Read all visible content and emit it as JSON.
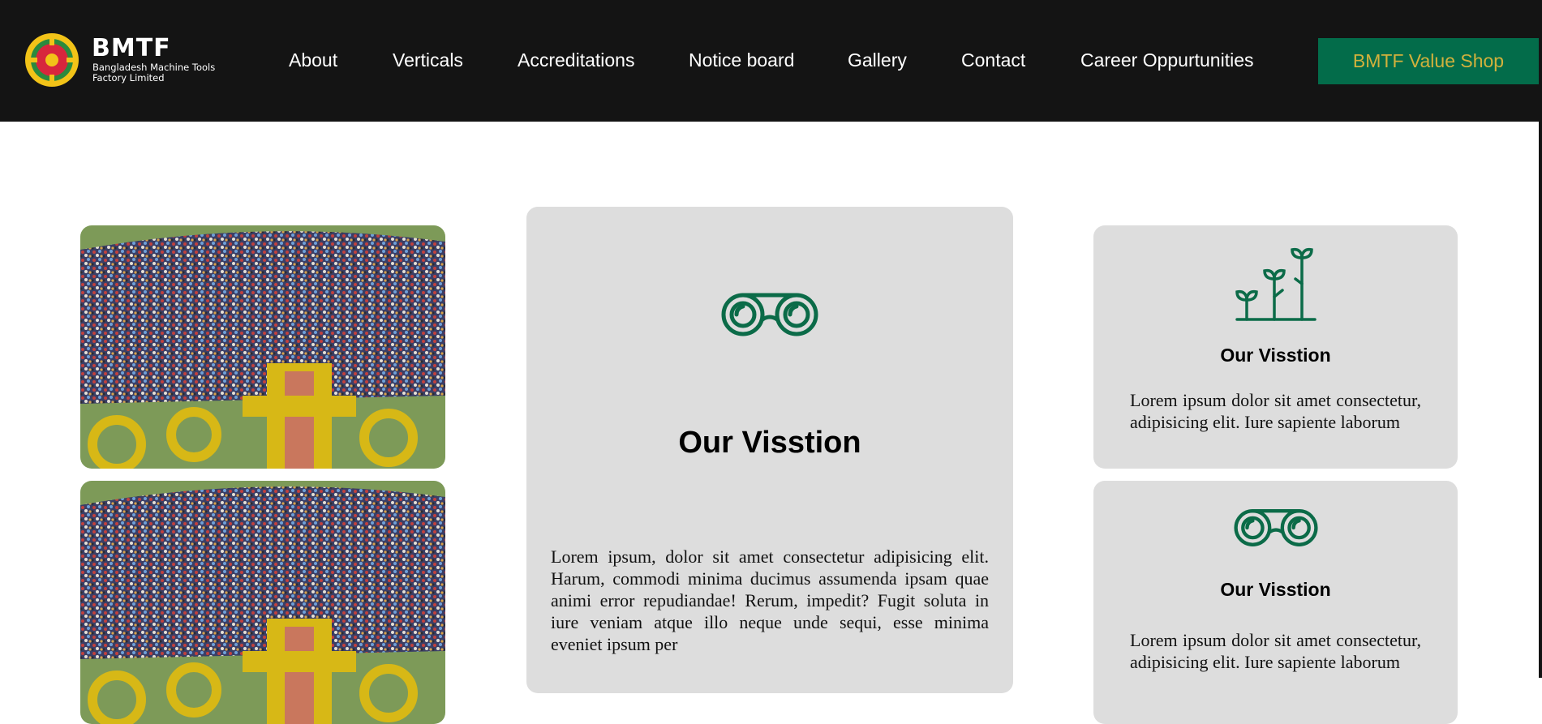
{
  "brand": {
    "name": "BMTF",
    "subtitle": "Bangladesh Machine Tools Factory Limited",
    "colors": {
      "header_bg": "#141414",
      "accent_green": "#036c4a",
      "accent_gold": "#d2b13c",
      "card_bg": "#dddddd"
    }
  },
  "nav": {
    "items": [
      {
        "label": "About"
      },
      {
        "label": "Verticals"
      },
      {
        "label": "Accreditations"
      },
      {
        "label": "Notice board"
      },
      {
        "label": "Gallery"
      },
      {
        "label": "Contact"
      },
      {
        "label": "Career Oppurtunities"
      }
    ],
    "shop_button": "BMTF Value Shop"
  },
  "main_card": {
    "icon": "binoculars-icon",
    "title": "Our Visstion",
    "text": "Lorem ipsum, dolor sit amet consectetur adipisicing elit. Harum, commodi minima ducimus assumenda ipsam quae animi error repudiandae! Rerum, impedit? Fugit soluta in iure veniam atque illo neque unde sequi, esse minima eveniet ipsum per"
  },
  "side_cards": [
    {
      "icon": "growth-sprouts-icon",
      "title": "Our Visstion",
      "text": "Lorem ipsum dolor sit amet consectetur, adipisicing elit. Iure sapiente laborum"
    },
    {
      "icon": "binoculars-icon",
      "title": "Our Visstion",
      "text": "Lorem ipsum dolor sit amet consectetur, adipisicing elit. Iure sapiente laborum"
    }
  ],
  "photos": [
    {
      "subject": "aerial-crowd-photo"
    },
    {
      "subject": "aerial-crowd-photo"
    }
  ]
}
